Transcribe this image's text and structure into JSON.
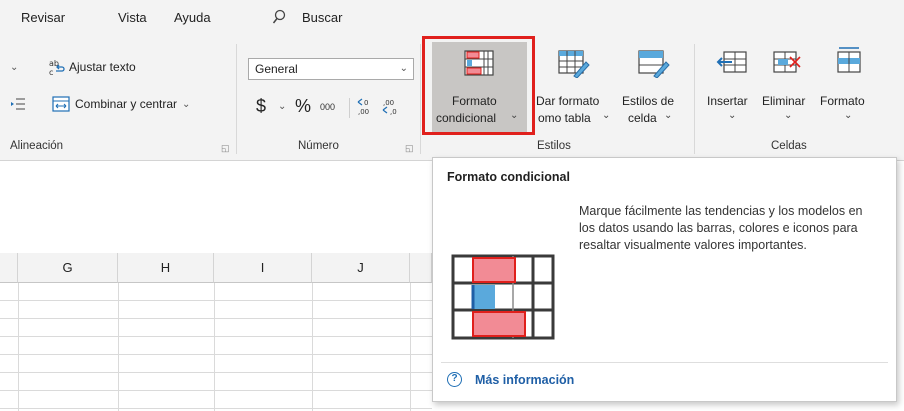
{
  "menu": {
    "revisar": "Revisar",
    "vista": "Vista",
    "ayuda": "Ayuda",
    "search_label": "Buscar"
  },
  "groups": {
    "alineacion": {
      "label": "Alineación",
      "wrap_text": "Ajustar texto",
      "merge_center": "Combinar y centrar"
    },
    "numero": {
      "label": "Número",
      "format_value": "General",
      "currency_symbol": "$",
      "percent_symbol": "%",
      "thousands_label": "000"
    },
    "estilos": {
      "label": "Estilos",
      "cond_format_line1": "Formato",
      "cond_format_line2": "condicional",
      "format_table_line1": "Dar formato",
      "format_table_line2": "omo tabla",
      "cell_styles_line1": "Estilos de",
      "cell_styles_line2": "celda"
    },
    "celdas": {
      "label": "Celdas",
      "insert": "Insertar",
      "delete": "Eliminar",
      "format": "Formato"
    }
  },
  "columns": [
    "G",
    "H",
    "I",
    "J"
  ],
  "tooltip": {
    "title": "Formato condicional",
    "description": "Marque fácilmente las tendencias y los modelos en los datos usando las barras, colores e iconos para resaltar visualmente valores importantes.",
    "help_glyph": "?",
    "link": "Más información"
  },
  "colors": {
    "highlight": "#e0201c",
    "link": "#1f5fa6",
    "bar_red": "#f28b95",
    "bar_blue": "#5aa9dc"
  },
  "icons": [
    "wrap-text-icon",
    "merge-center-icon",
    "conditional-format-icon",
    "format-as-table-icon",
    "cell-styles-icon",
    "insert-cells-icon",
    "delete-cells-icon",
    "format-cells-icon",
    "search-icon",
    "help-icon"
  ]
}
